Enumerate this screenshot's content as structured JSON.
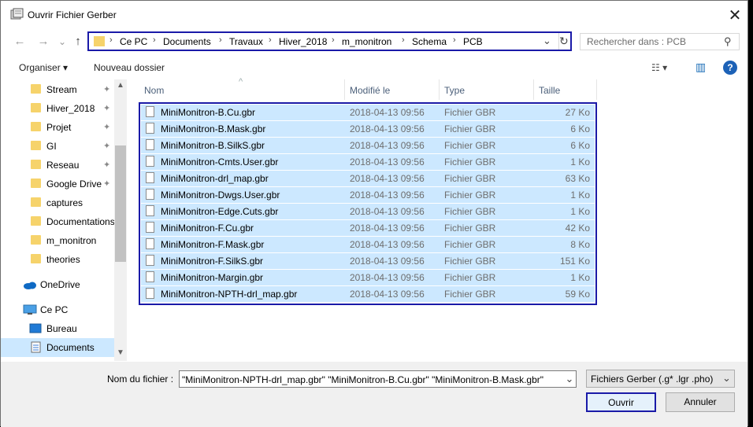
{
  "window": {
    "title": "Ouvrir Fichier Gerber",
    "close_glyph": "✕"
  },
  "nav": {
    "back_glyph": "←",
    "forward_glyph": "→",
    "history_glyph": "⌄",
    "up_glyph": "↑"
  },
  "address": {
    "crumbs": [
      "Ce PC",
      "Documents",
      "Travaux",
      "Hiver_2018",
      "m_monitron",
      "Schema",
      "PCB"
    ],
    "sep": "›",
    "dropdown_glyph": "⌄",
    "refresh_glyph": "↻"
  },
  "search": {
    "placeholder": "Rechercher dans : PCB",
    "icon_glyph": "⚲"
  },
  "toolbar": {
    "organize": "Organiser ▾",
    "new_folder": "Nouveau dossier",
    "view_glyph": "☷ ▾",
    "pane_glyph": "▥",
    "help_glyph": "?"
  },
  "sidebar": {
    "items": [
      {
        "label": "Stream",
        "pinned": true
      },
      {
        "label": "Hiver_2018",
        "pinned": true
      },
      {
        "label": "Projet",
        "pinned": true
      },
      {
        "label": "GI",
        "pinned": true
      },
      {
        "label": "Reseau",
        "pinned": true
      },
      {
        "label": "Google Drive",
        "pinned": true
      },
      {
        "label": "captures",
        "pinned": false
      },
      {
        "label": "Documentations",
        "pinned": false
      },
      {
        "label": "m_monitron",
        "pinned": false
      },
      {
        "label": "theories",
        "pinned": false
      }
    ],
    "onedrive": "OneDrive",
    "thispc": "Ce PC",
    "bureau": "Bureau",
    "documents": "Documents",
    "pin_glyph": "📌"
  },
  "columns": {
    "name": "Nom",
    "modified": "Modifié le",
    "type": "Type",
    "size": "Taille",
    "sort_glyph": "^"
  },
  "files": [
    {
      "name": "MiniMonitron-B.Cu.gbr",
      "date": "2018-04-13 09:56",
      "type": "Fichier GBR",
      "size": "27 Ko"
    },
    {
      "name": "MiniMonitron-B.Mask.gbr",
      "date": "2018-04-13 09:56",
      "type": "Fichier GBR",
      "size": "6 Ko"
    },
    {
      "name": "MiniMonitron-B.SilkS.gbr",
      "date": "2018-04-13 09:56",
      "type": "Fichier GBR",
      "size": "6 Ko"
    },
    {
      "name": "MiniMonitron-Cmts.User.gbr",
      "date": "2018-04-13 09:56",
      "type": "Fichier GBR",
      "size": "1 Ko"
    },
    {
      "name": "MiniMonitron-drl_map.gbr",
      "date": "2018-04-13 09:56",
      "type": "Fichier GBR",
      "size": "63 Ko"
    },
    {
      "name": "MiniMonitron-Dwgs.User.gbr",
      "date": "2018-04-13 09:56",
      "type": "Fichier GBR",
      "size": "1 Ko"
    },
    {
      "name": "MiniMonitron-Edge.Cuts.gbr",
      "date": "2018-04-13 09:56",
      "type": "Fichier GBR",
      "size": "1 Ko"
    },
    {
      "name": "MiniMonitron-F.Cu.gbr",
      "date": "2018-04-13 09:56",
      "type": "Fichier GBR",
      "size": "42 Ko"
    },
    {
      "name": "MiniMonitron-F.Mask.gbr",
      "date": "2018-04-13 09:56",
      "type": "Fichier GBR",
      "size": "8 Ko"
    },
    {
      "name": "MiniMonitron-F.SilkS.gbr",
      "date": "2018-04-13 09:56",
      "type": "Fichier GBR",
      "size": "151 Ko"
    },
    {
      "name": "MiniMonitron-Margin.gbr",
      "date": "2018-04-13 09:56",
      "type": "Fichier GBR",
      "size": "1 Ko"
    },
    {
      "name": "MiniMonitron-NPTH-drl_map.gbr",
      "date": "2018-04-13 09:56",
      "type": "Fichier GBR",
      "size": "59 Ko"
    }
  ],
  "footer": {
    "filename_label": "Nom du fichier :",
    "filename_value": "\"MiniMonitron-NPTH-drl_map.gbr\" \"MiniMonitron-B.Cu.gbr\" \"MiniMonitron-B.Mask.gbr\"",
    "filetype_value": "Fichiers Gerber (.g* .lgr .pho)",
    "dropdown_glyph": "⌄",
    "open": "Ouvrir",
    "cancel": "Annuler"
  },
  "colors": {
    "selection": "#cce8ff",
    "highlight_border": "#1a1aa8",
    "folder": "#f6d36b"
  }
}
